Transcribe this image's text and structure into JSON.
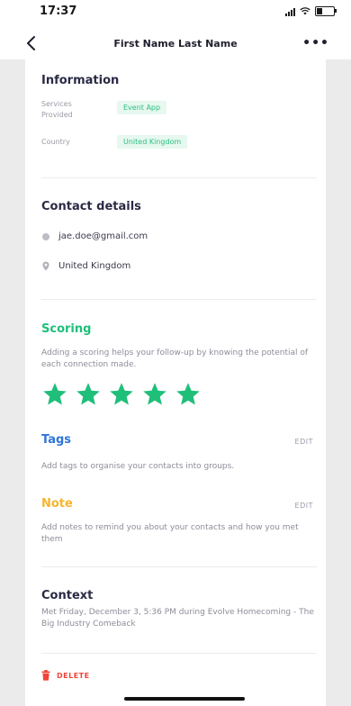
{
  "status_bar": {
    "time": "17:37"
  },
  "nav": {
    "title": "First Name Last Name",
    "more_label": "•••"
  },
  "information": {
    "title": "Information",
    "rows": [
      {
        "label": "Services Provided",
        "value": "Event App"
      },
      {
        "label": "Country",
        "value": "United Kingdom"
      }
    ]
  },
  "contact": {
    "title": "Contact details",
    "email": "jae.doe@gmail.com",
    "location": "United Kingdom"
  },
  "scoring": {
    "title": "Scoring",
    "description": "Adding a scoring helps your follow-up by knowing the potential of each connection made.",
    "rating": 5,
    "max": 5,
    "star_color": "#1fbf7a"
  },
  "tags": {
    "title": "Tags",
    "edit_label": "EDIT",
    "description": "Add tags to organise your contacts into groups.",
    "color": "#2f74d8"
  },
  "note": {
    "title": "Note",
    "edit_label": "EDIT",
    "description": "Add notes to remind you about your contacts and how you met them",
    "color": "#f6b52d"
  },
  "context": {
    "title": "Context",
    "description": "Met Friday, December 3, 5:36 PM during Evolve Homecoming - The Big Industry Comeback"
  },
  "actions": {
    "delete_label": "DELETE",
    "delete_color": "#f04438"
  },
  "icons": {
    "back": "chevron-left-icon",
    "email": "email-icon",
    "location": "location-pin-icon",
    "star": "star-icon",
    "delete": "trash-icon"
  }
}
